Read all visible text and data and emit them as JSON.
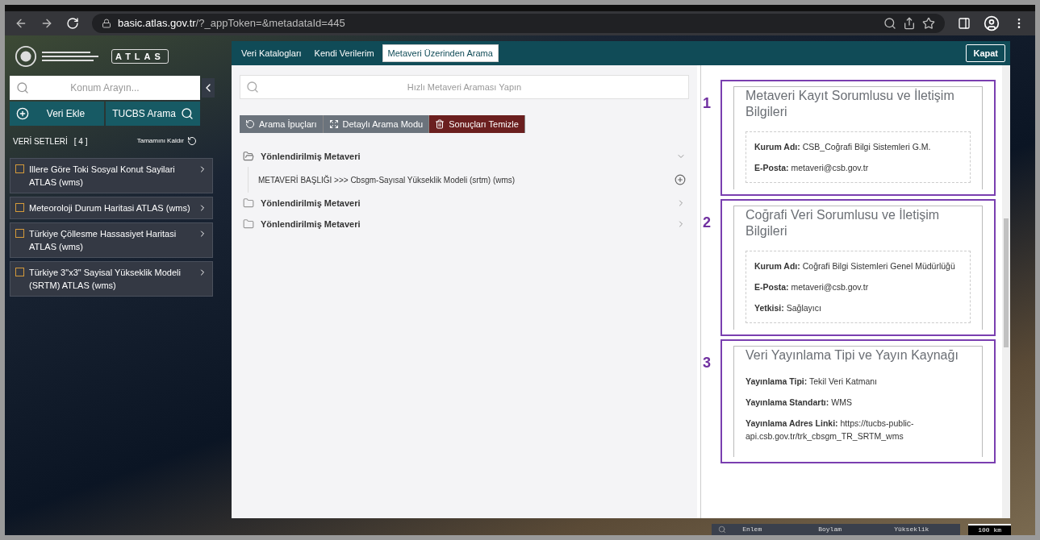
{
  "browser": {
    "url_host": "basic.atlas.gov.tr",
    "url_path": "/?_appToken=&metadataId=445"
  },
  "logo": {
    "text": "ATLAS"
  },
  "sidebar": {
    "search": {
      "placeholder": "Konum Arayın..."
    },
    "buttons": [
      {
        "label": "Veri Ekle",
        "kind": "add"
      },
      {
        "label": "TUCBS Arama",
        "kind": "search"
      }
    ],
    "datasets_label": "VERİ SETLERİ",
    "datasets_count": "[ 4 ]",
    "remove_all": "Tamamını Kaldır",
    "layers": [
      {
        "name": "Illere Göre Toki Sosyal Konut Sayilari ATLAS (wms)",
        "checked": false
      },
      {
        "name": "Meteoroloji Durum Haritasi ATLAS (wms)",
        "checked": false
      },
      {
        "name": "Türkiye Çöllesme Hassasiyet Haritasi ATLAS (wms)",
        "checked": false
      },
      {
        "name": "Türkiye 3\"x3\" Sayisal Yükseklik Modeli (SRTM) ATLAS (wms)",
        "checked": false
      }
    ]
  },
  "modal": {
    "tabs": [
      {
        "label": "Veri Katalogları",
        "selected": false
      },
      {
        "label": "Kendi Verilerim",
        "selected": false
      },
      {
        "label": "Metaveri Üzerinden Arama",
        "selected": true
      }
    ],
    "close": "Kapat",
    "search": {
      "placeholder": "Hızlı Metaveri Araması Yapın"
    },
    "actions": [
      {
        "label": "Arama İpuçları",
        "kind": "hints"
      },
      {
        "label": "Detaylı Arama Modu",
        "kind": "expand"
      },
      {
        "label": "Sonuçları Temizle",
        "kind": "clear"
      }
    ],
    "tree": [
      {
        "label": "Yönlendirilmiş Metaveri",
        "expanded": true,
        "children": [
          {
            "label": "METAVERİ BAŞLIĞI >>> Cbsgm-Sayısal Yükseklik Modeli (srtm) (wms)"
          }
        ]
      },
      {
        "label": "Yönlendirilmiş Metaveri",
        "expanded": false
      },
      {
        "label": "Yönlendirilmiş Metaveri",
        "expanded": false
      }
    ],
    "sections": [
      {
        "number": "1",
        "title": "Metaveri Kayıt Sorumlusu ve İletişim Bilgileri",
        "kind": "contact",
        "fields": [
          {
            "label": "Kurum Adı:",
            "value": "CSB_Coğrafi Bilgi Sistemleri G.M."
          },
          {
            "label": "E-Posta:",
            "value": "metaveri@csb.gov.tr"
          }
        ]
      },
      {
        "number": "2",
        "title": "Coğrafi Veri Sorumlusu ve İletişim Bilgileri",
        "kind": "contact",
        "fields": [
          {
            "label": "Kurum Adı:",
            "value": "Coğrafi Bilgi Sistemleri Genel Müdürlüğü"
          },
          {
            "label": "E-Posta:",
            "value": "metaveri@csb.gov.tr"
          },
          {
            "label": "Yetkisi:",
            "value": "Sağlayıcı"
          }
        ]
      },
      {
        "number": "3",
        "title": "Veri Yayınlama Tipi ve Yayın Kaynağı",
        "kind": "publication",
        "fields": [
          {
            "label": "Yayınlama Tipi:",
            "value": "Tekil Veri Katmanı"
          },
          {
            "label": "Yayınlama Standartı:",
            "value": "WMS"
          },
          {
            "label": "Yayınlama Adres Linki:",
            "value": "https://tucbs-public-api.csb.gov.tr/trk_cbsgm_TR_SRTM_wms"
          }
        ]
      }
    ]
  },
  "status_bar": {
    "columns": [
      "Enlem",
      "Boylam",
      "Yükseklik"
    ],
    "scale": "100 km"
  }
}
